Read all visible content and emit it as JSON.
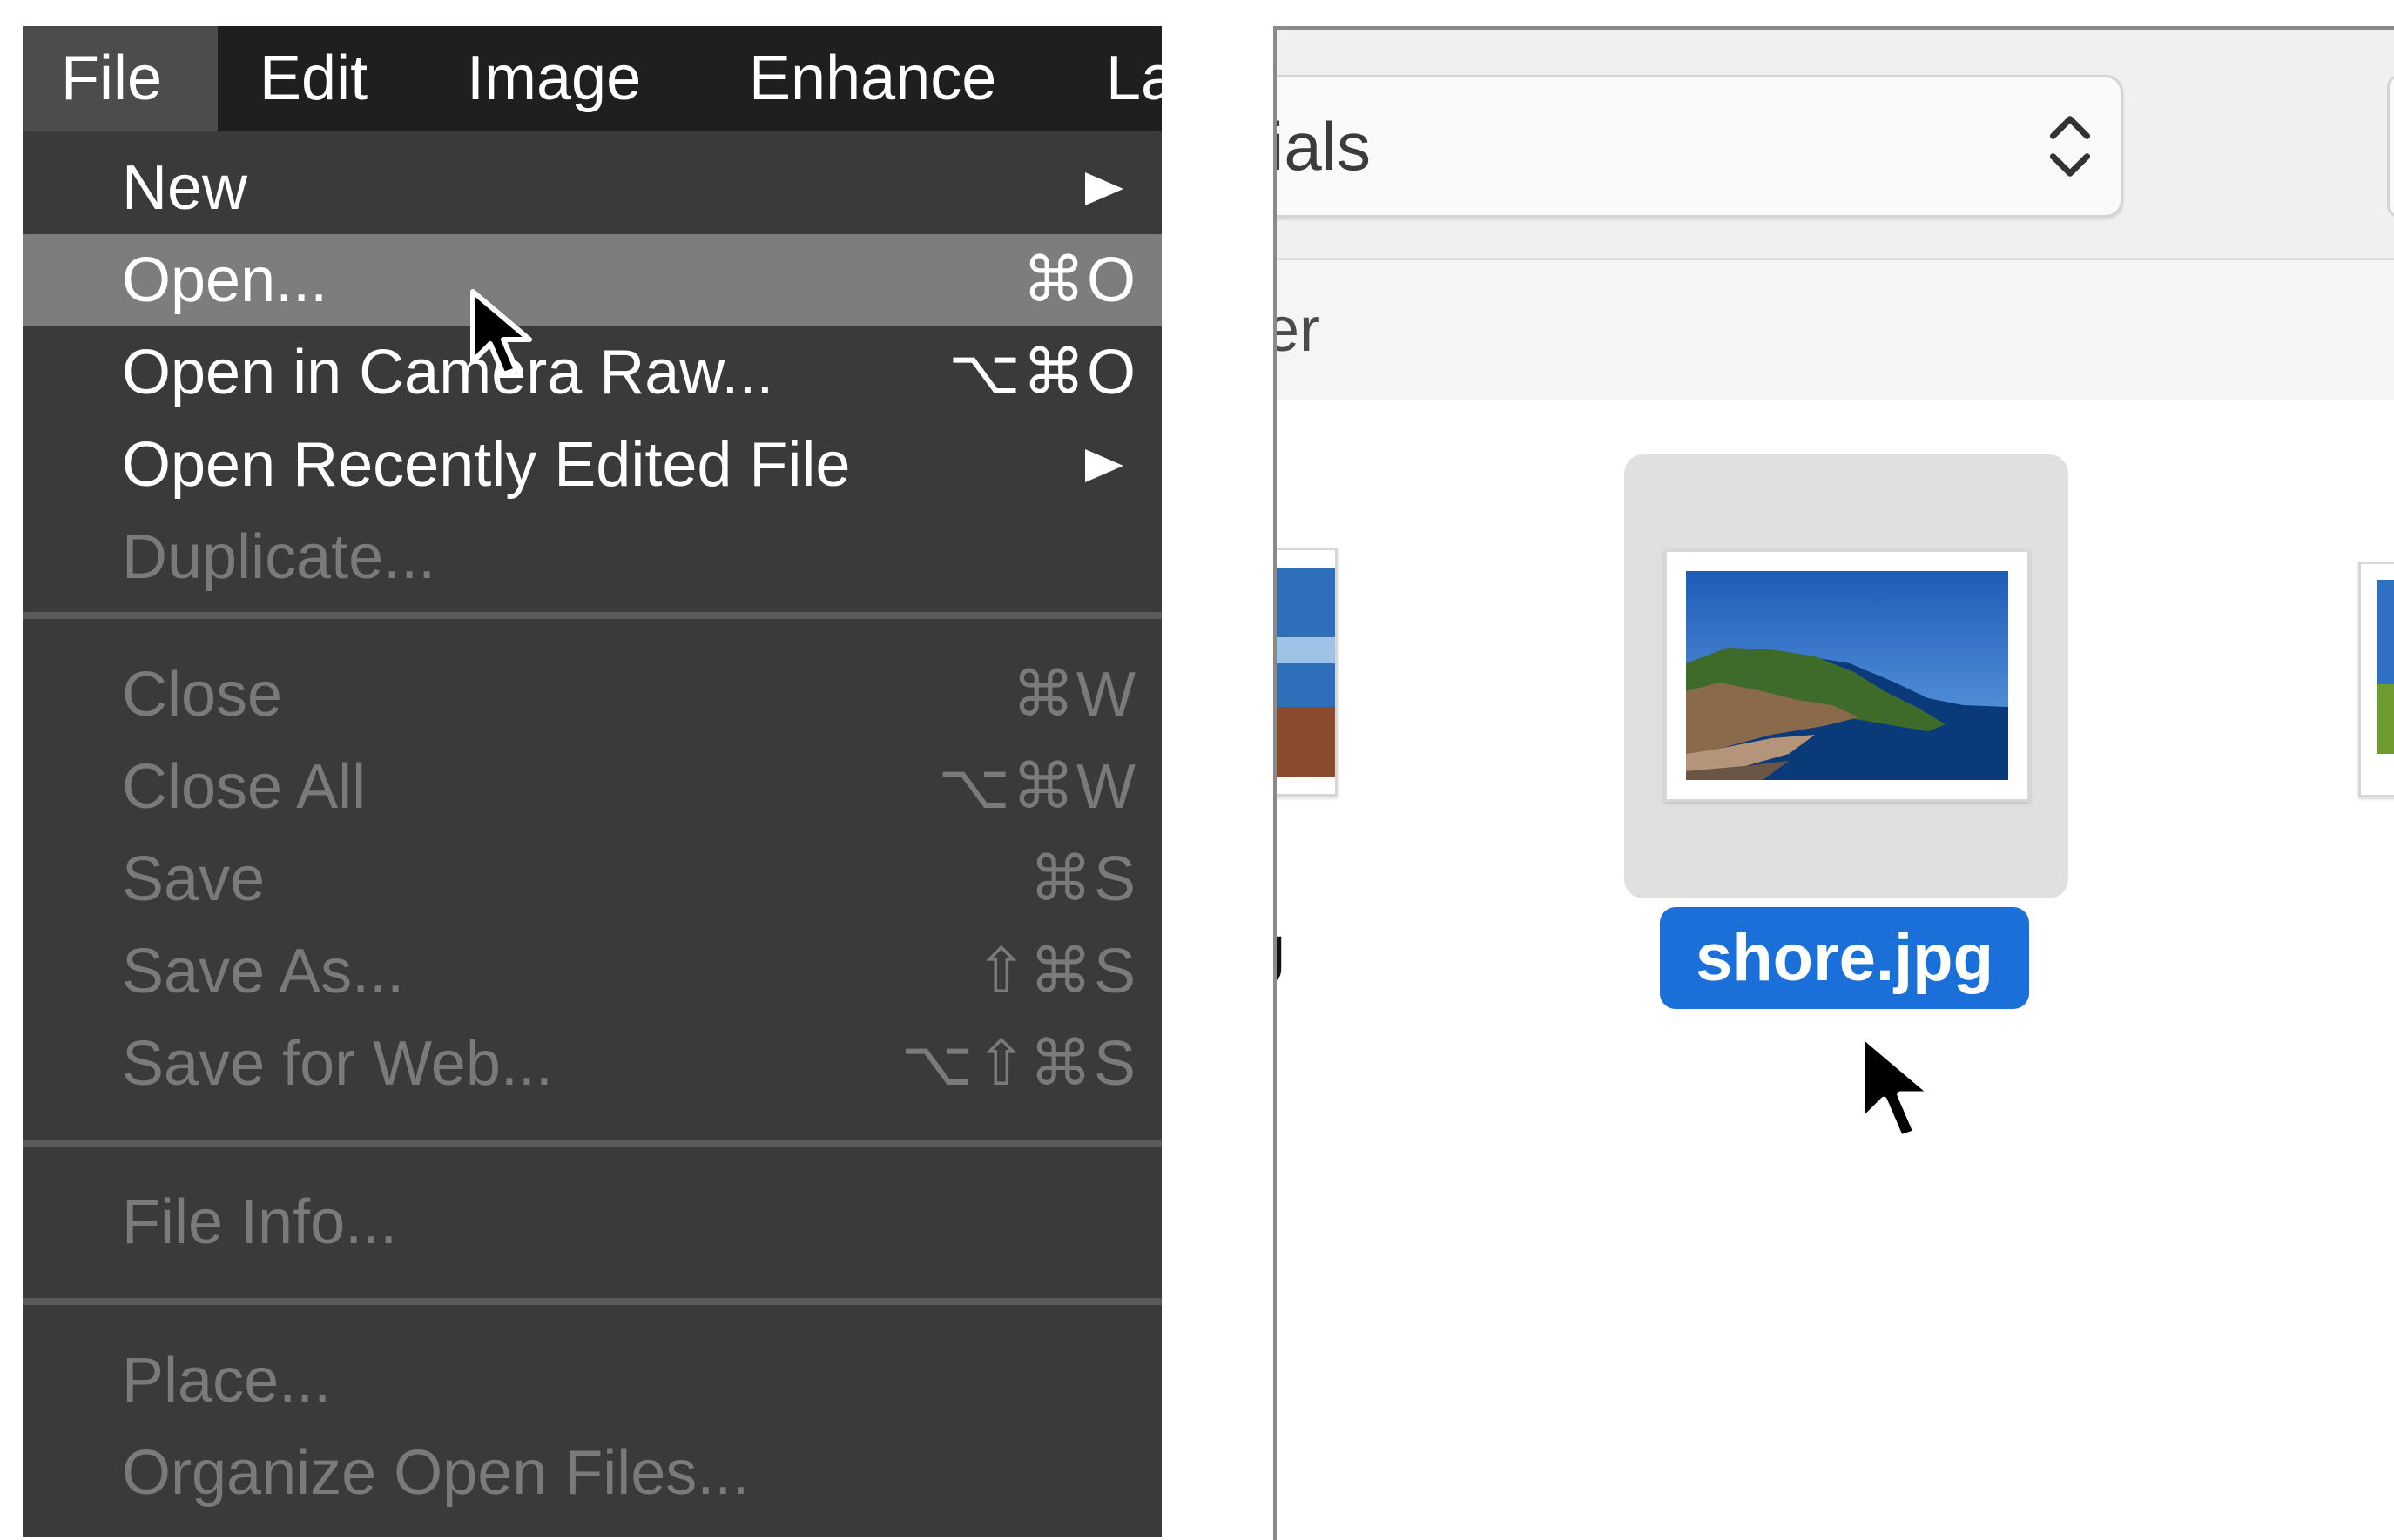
{
  "menubar": {
    "items": [
      {
        "label": "File"
      },
      {
        "label": "Edit"
      },
      {
        "label": "Image"
      },
      {
        "label": "Enhance"
      },
      {
        "label": "La"
      }
    ]
  },
  "file_menu": {
    "group1": [
      {
        "label": "New",
        "shortcut": "",
        "submenu": true,
        "enabled": true
      },
      {
        "label": "Open...",
        "shortcut": "⌘O",
        "submenu": false,
        "enabled": true,
        "highlighted": true
      },
      {
        "label": "Open in Camera Raw...",
        "shortcut": "⌥⌘O",
        "submenu": false,
        "enabled": true
      },
      {
        "label": "Open Recently Edited File",
        "shortcut": "",
        "submenu": true,
        "enabled": true
      },
      {
        "label": "Duplicate...",
        "shortcut": "",
        "submenu": false,
        "enabled": false
      }
    ],
    "group2": [
      {
        "label": "Close",
        "shortcut": "⌘W",
        "enabled": false
      },
      {
        "label": "Close All",
        "shortcut": "⌥⌘W",
        "enabled": false
      },
      {
        "label": "Save",
        "shortcut": "⌘S",
        "enabled": false
      },
      {
        "label": "Save As...",
        "shortcut": "⇧⌘S",
        "enabled": false
      },
      {
        "label": "Save for Web...",
        "shortcut": "⌥⇧⌘S",
        "enabled": false
      }
    ],
    "group3": [
      {
        "label": "File Info...",
        "enabled": false
      }
    ],
    "group4": [
      {
        "label": "Place...",
        "enabled": false
      },
      {
        "label": "Organize Open Files...",
        "enabled": false
      }
    ]
  },
  "dialog": {
    "location_popup_text": "ials",
    "path_text": "ler",
    "files": {
      "left_label": "g",
      "selected_label": "shore.jpg"
    }
  },
  "colors": {
    "menu_bg": "#3a3a3a",
    "menubar_bg": "#1f1f1f",
    "highlight": "#7d7d7d",
    "selection_blue": "#1a6fd8"
  },
  "icons": {
    "submenu": "triangle-right-icon",
    "stepper": "up-down-chevron-icon",
    "cursor": "mouse-pointer-icon"
  }
}
